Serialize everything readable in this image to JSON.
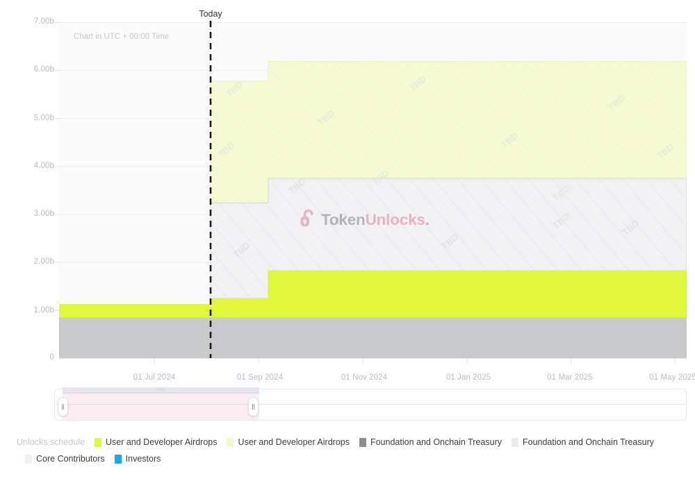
{
  "chart_data": {
    "type": "area",
    "title": "",
    "subtitle": "Chart in UTC + 00:00 Time",
    "xlabel": "",
    "ylabel": "",
    "ylim": [
      0,
      7000000000
    ],
    "grid": true,
    "legend_position": "bottom",
    "stacked": true,
    "step": "post",
    "y_ticks": [
      "0",
      "1.00b",
      "2.00b",
      "3.00b",
      "4.00b",
      "5.00b",
      "6.00b",
      "7.00b"
    ],
    "y_tick_values": [
      0,
      1000000000,
      2000000000,
      3000000000,
      4000000000,
      5000000000,
      6000000000,
      7000000000
    ],
    "x_ticks": [
      "01 Jul 2024",
      "01 Sep 2024",
      "01 Nov 2024",
      "01 Jan 2025",
      "01 Mar 2025",
      "01 May 2025"
    ],
    "today_marker": {
      "label": "Today",
      "x": "2024 Aug 01"
    },
    "hatch_label": "TBD",
    "x": [
      "2024-06-01",
      "2024-09-05",
      "2025-05-10"
    ],
    "series": [
      {
        "name": "Foundation and Onchain Treasury",
        "kind": "unlocked",
        "color": "#c8c9cb",
        "hatched": false,
        "values": [
          0.78,
          0.78,
          0.78
        ]
      },
      {
        "name": "User and Developer Airdrops",
        "kind": "unlocked",
        "color": "#e0f83c",
        "hatched": false,
        "values": [
          0.27,
          0.47,
          1.01
        ]
      },
      {
        "name": "Foundation and Onchain Treasury",
        "kind": "tbd",
        "color": "#efeff1",
        "hatched": true,
        "values": [
          0.0,
          1.95,
          1.95
        ]
      },
      {
        "name": "User and Developer Airdrops",
        "kind": "tbd",
        "color": "#f3fad1",
        "hatched": true,
        "values": [
          0.0,
          2.45,
          2.45
        ]
      }
    ],
    "cumulative_totals": [
      1.05,
      5.65,
      6.19
    ]
  },
  "axis": {
    "y_labels": [
      "7.00b",
      "6.00b",
      "5.00b",
      "4.00b",
      "3.00b",
      "2.00b",
      "1.00b",
      "0"
    ],
    "x_labels": [
      "01 Jul 2024",
      "01 Sep 2024",
      "01 Nov 2024",
      "01 Jan 2025",
      "01 Mar 2025",
      "01 May 2025"
    ]
  },
  "annotations": {
    "today": "Today",
    "utc_note": "Chart in UTC + 00:00 Time",
    "hatch_text": "TBD"
  },
  "watermark": {
    "part1": "Token",
    "part2": "Unlocks",
    "dot": ".",
    "icon": "open-lock-icon"
  },
  "range_selector": {
    "handle_left": "range-handle-left",
    "handle_right": "range-handle-right",
    "selection_label": "TBD"
  },
  "legend": {
    "title": "Unlocks schedule",
    "items": [
      {
        "label": "User and Developer Airdrops",
        "color": "#e0f83c"
      },
      {
        "label": "User and Developer Airdrops",
        "color": "#f2f9c6"
      },
      {
        "label": "Foundation and Onchain Treasury",
        "color": "#8b8d91"
      },
      {
        "label": "Foundation and Onchain Treasury",
        "color": "#e9eaec"
      },
      {
        "label": "Core Contributors",
        "color": "#eef0f7"
      },
      {
        "label": "Investors",
        "color": "#15a9ee"
      }
    ]
  },
  "colors": {
    "grid": "#e9eaec",
    "plot_bg": "#fbfbfc",
    "axis_text": "#b9bcc2",
    "today_line": "#1a1a1a"
  }
}
